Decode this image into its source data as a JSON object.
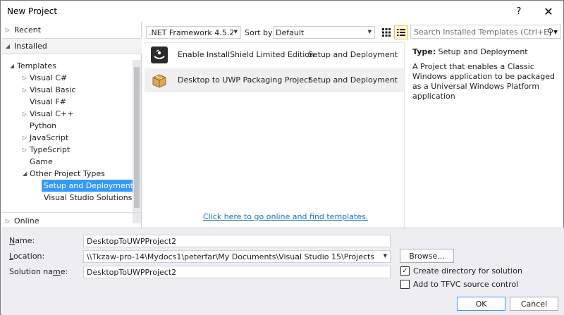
{
  "window": {
    "title": "New Project",
    "help_label": "?",
    "close_label": "✕"
  },
  "left": {
    "recent_label": "Recent",
    "installed_label": "Installed",
    "online_label": "Online",
    "tree": [
      {
        "label": "Templates",
        "arrow": "◢"
      },
      {
        "label": "Visual C#",
        "arrow": "▷"
      },
      {
        "label": "Visual Basic",
        "arrow": "▷"
      },
      {
        "label": "Visual F#",
        "arrow": ""
      },
      {
        "label": "Visual C++",
        "arrow": "▷"
      },
      {
        "label": "Python",
        "arrow": ""
      },
      {
        "label": "JavaScript",
        "arrow": "▷"
      },
      {
        "label": "TypeScript",
        "arrow": "▷"
      },
      {
        "label": "Game",
        "arrow": ""
      },
      {
        "label": "Other Project Types",
        "arrow": "◢"
      },
      {
        "label": "Setup and Deployment",
        "arrow": ""
      },
      {
        "label": "Visual Studio Solutions",
        "arrow": ""
      }
    ]
  },
  "toolbar": {
    "framework": ".NET Framework 4.5.2",
    "sort_by_label": "Sort by:",
    "sort_by_value": "Default",
    "search_placeholder": "Search Installed Templates (Ctrl+E)"
  },
  "templates": [
    {
      "name": "Enable InstallShield Limited Edition",
      "category": "Setup and Deployment",
      "icon": "installshield-icon"
    },
    {
      "name": "Desktop to UWP Packaging Project",
      "category": "Setup and Deployment",
      "icon": "package-box-icon"
    }
  ],
  "online_link": "Click here to go online and find templates.",
  "description": {
    "type_label": "Type:",
    "type_value": "Setup and Deployment",
    "text": "A Project that enables a Classic Windows application to be packaged as a Universal Windows Platform application"
  },
  "form": {
    "name_label_u": "N",
    "name_label_rest": "ame:",
    "name_value": "DesktopToUWPProject2",
    "location_label_u": "L",
    "location_label_rest": "ocation:",
    "location_value": "\\\\Tkzaw-pro-14\\Mydocs1\\peterfar\\My Documents\\Visual Studio 15\\Projects",
    "solution_label_pre": "Solution na",
    "solution_label_u": "m",
    "solution_label_rest": "e:",
    "solution_value": "DesktopToUWPProject2",
    "browse_label": "Browse...",
    "create_dir_label": "Create directory for solution",
    "create_dir_checked": "✓",
    "tfvc_label": "Add to TFVC source control",
    "ok_label": "OK",
    "cancel_label": "Cancel"
  }
}
